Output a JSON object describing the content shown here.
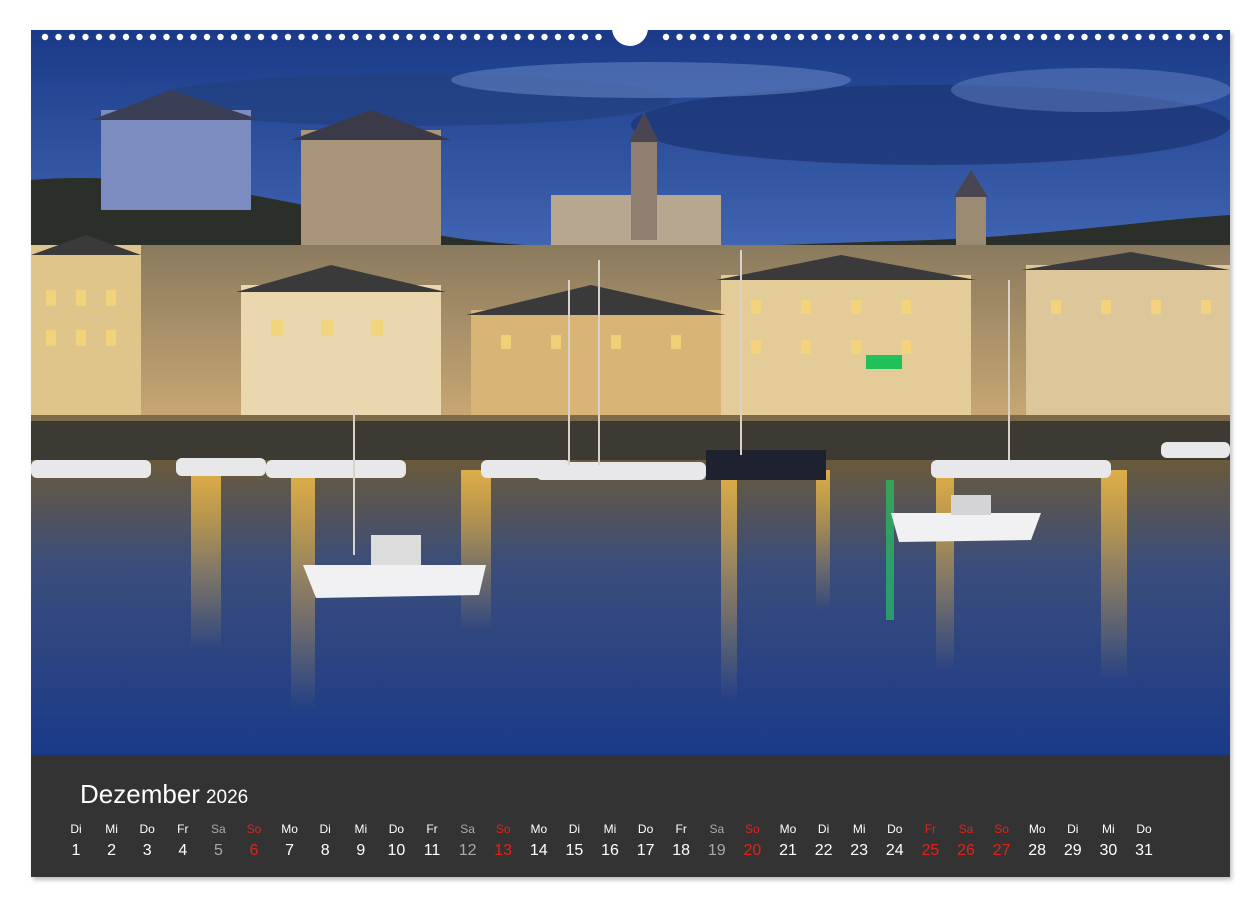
{
  "calendar": {
    "month": "Dezember",
    "year": "2026",
    "day_names": [
      "Di",
      "Mi",
      "Do",
      "Fr",
      "Sa",
      "So",
      "Mo",
      "Di",
      "Mi",
      "Do",
      "Fr",
      "Sa",
      "So",
      "Mo",
      "Di",
      "Mi",
      "Do",
      "Fr",
      "Sa",
      "So",
      "Mo",
      "Di",
      "Mi",
      "Do",
      "Fr",
      "Sa",
      "So",
      "Mo",
      "Di",
      "Mi",
      "Do"
    ],
    "days": [
      "1",
      "2",
      "3",
      "4",
      "5",
      "6",
      "7",
      "8",
      "9",
      "10",
      "11",
      "12",
      "13",
      "14",
      "15",
      "16",
      "17",
      "18",
      "19",
      "20",
      "21",
      "22",
      "23",
      "24",
      "25",
      "26",
      "27",
      "28",
      "29",
      "30",
      "31"
    ],
    "saturday_days": [
      5,
      12,
      19
    ],
    "red_days": [
      6,
      13,
      20,
      25,
      26,
      27
    ],
    "colors": {
      "strip_background": "#333333",
      "text": "#ffffff",
      "saturday": "#a9a9a9",
      "sunday_holiday": "#e0241b"
    }
  },
  "photo": {
    "subject": "harbor-town-at-dusk",
    "colors": {
      "sky_top": "#1c3e8c",
      "sky_horizon": "#5d7fc2",
      "water": "#1f3f8a",
      "light_reflection": "#d8a23c"
    }
  }
}
